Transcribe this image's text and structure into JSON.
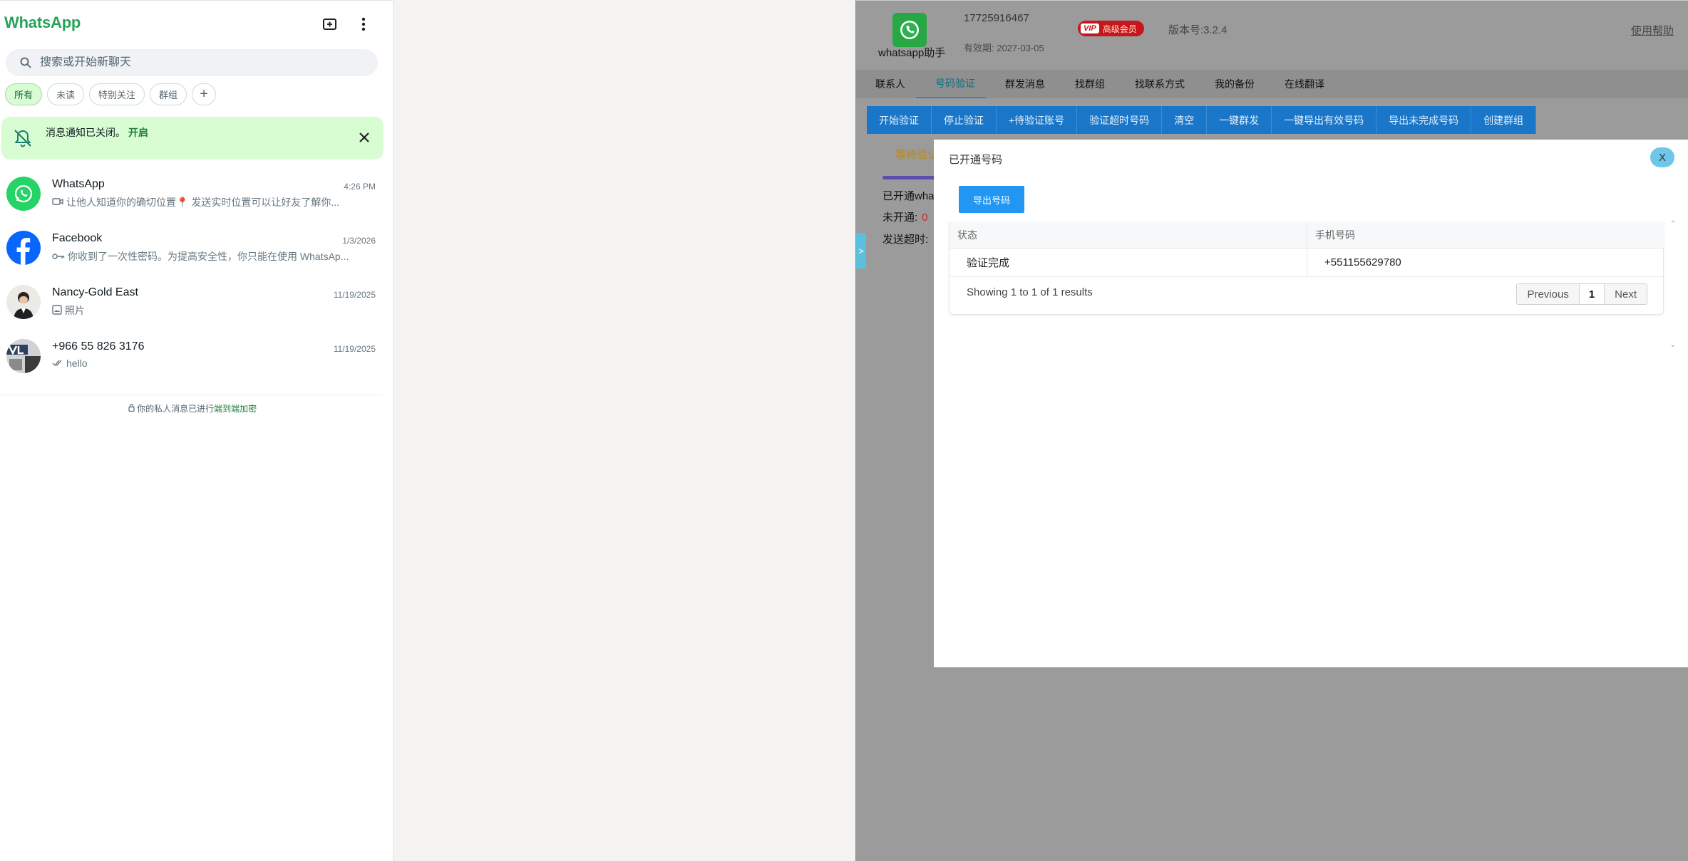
{
  "wa": {
    "title": "WhatsApp",
    "search_placeholder": "搜索或开始新聊天",
    "filters": [
      "所有",
      "未读",
      "特别关注",
      "群组"
    ],
    "filter_add": "+",
    "notice": {
      "text": "消息通知已关闭。",
      "link": "开启"
    },
    "chats": [
      {
        "name": "WhatsApp",
        "time": "4:26 PM",
        "preview": "让他人知道你的确切位置📍 发送实时位置可以让好友了解你..."
      },
      {
        "name": "Facebook",
        "time": "1/3/2026",
        "preview": "你收到了一次性密码。为提高安全性，你只能在使用 WhatsAp..."
      },
      {
        "name": "Nancy-Gold East",
        "time": "11/19/2025",
        "preview": "照片"
      },
      {
        "name": "+966 55 826 3176",
        "time": "11/19/2025",
        "preview": "hello"
      }
    ],
    "e2e": {
      "text": "你的私人消息已进行",
      "link": "端到端加密"
    }
  },
  "helper": {
    "logo_label": "whatsapp助手",
    "phone": "17725916467",
    "expire": "有效期: 2027-03-05",
    "vip_tag": "VIP",
    "vip_label": "高级会员",
    "version": "版本号:3.2.4",
    "help": "使用帮助",
    "nav": [
      "联系人",
      "号码验证",
      "群发消息",
      "找群组",
      "找联系方式",
      "我的备份",
      "在线翻译"
    ],
    "toolbar": [
      "开始验证",
      "停止验证",
      "+待验证账号",
      "验证超时号码",
      "清空",
      "一键群发",
      "一键导出有效号码",
      "导出未完成号码",
      "创建群组"
    ],
    "under": {
      "tab": "等待验证",
      "opened": "已开通wha",
      "unopened_label": "未开通:",
      "unopened_value": "0",
      "timeout": "发送超时:"
    },
    "side_tab": ">",
    "modal": {
      "title": "已开通号码",
      "close": "X",
      "export": "导出号码",
      "columns": [
        "状态",
        "手机号码"
      ],
      "rows": [
        {
          "status": "验证完成",
          "phone": "+551155629780"
        }
      ],
      "info": "Showing 1 to 1 of 1 results",
      "prev": "Previous",
      "page": "1",
      "next": "Next"
    }
  },
  "colors": {
    "wa_green": "#25a35a",
    "notice_bg": "#d9fdd3",
    "toolbar_blue": "#1976c8",
    "export_blue": "#2196f3",
    "vip_red": "#c7151b"
  }
}
